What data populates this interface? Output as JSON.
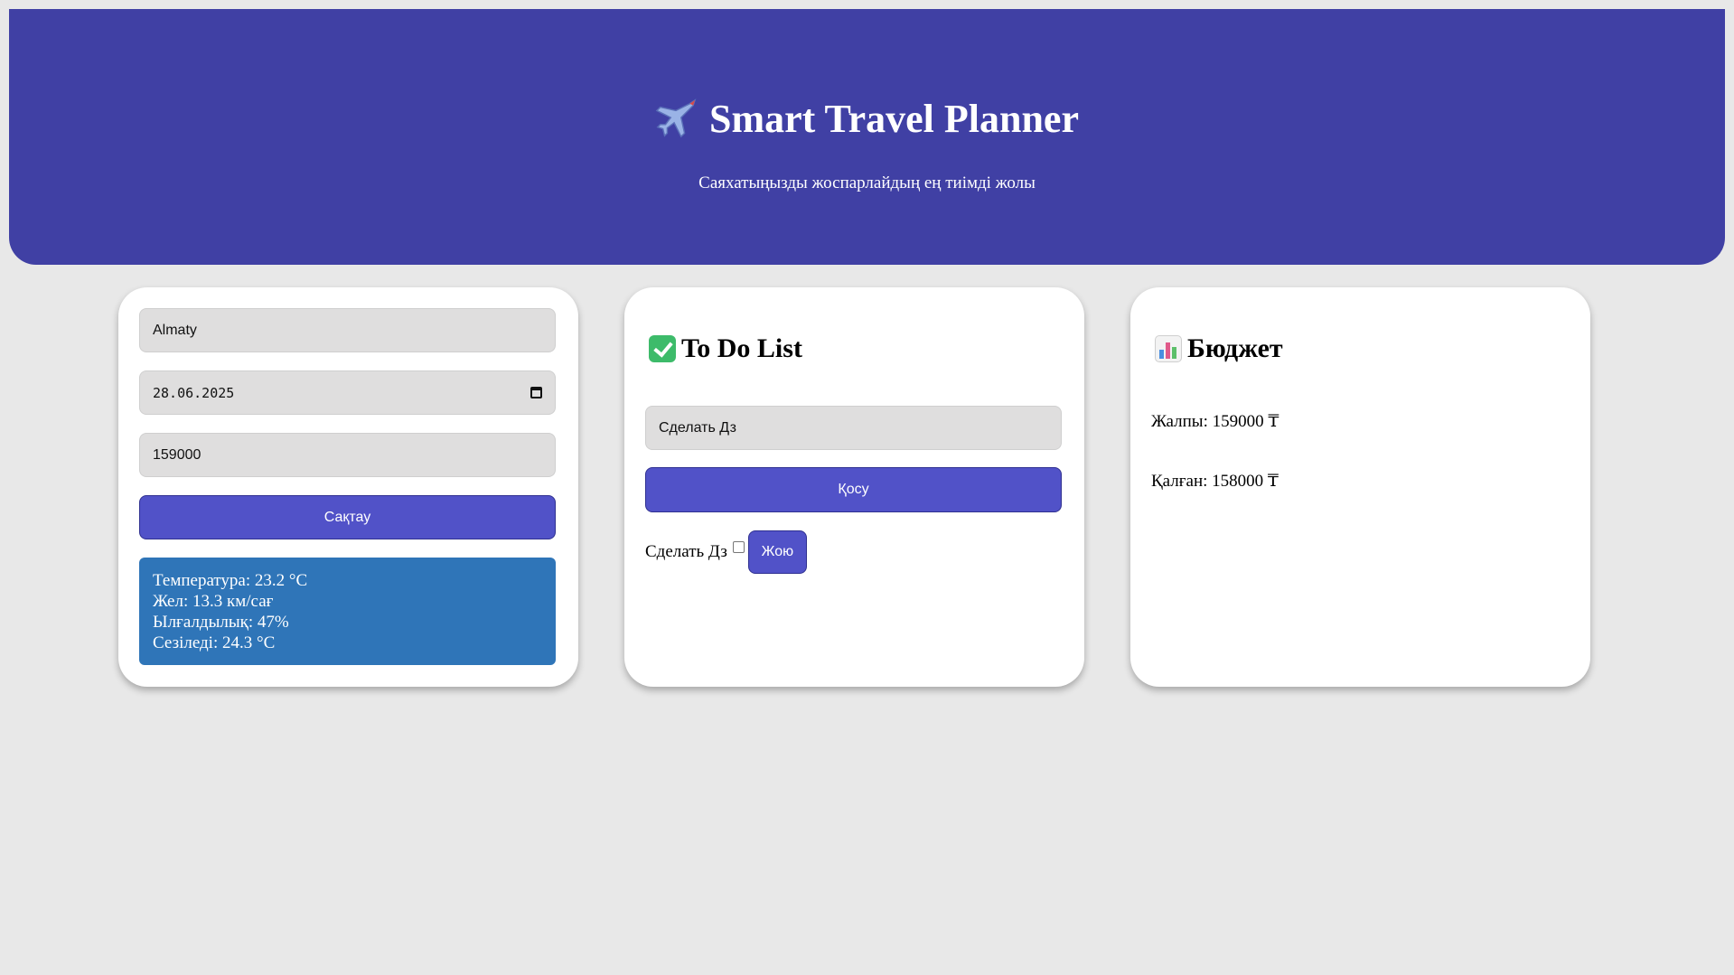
{
  "header": {
    "title": "Smart Travel Planner",
    "subtitle": "Саяхатыңызды жоспарлайдың ең тиімді жолы",
    "background_color": "#4040a4",
    "title_icon": "airplane-icon"
  },
  "trip_form": {
    "city_value": "Almaty",
    "date_value": "28.06.2025",
    "budget_value": "159000",
    "save_label": "Сақтау",
    "accent_color": "#5152c8"
  },
  "weather": {
    "temperature": "Температура: 23.2 °C",
    "wind": "Жел: 13.3 км/сағ",
    "humidity": "Ылғалдылық: 47%",
    "feels_like": "Сезіледі: 24.3 °C",
    "background_color": "#2f75b8"
  },
  "todo": {
    "title": "To Do List",
    "title_icon": "check-icon",
    "input_value": "Сделать Дз",
    "add_label": "Қосу",
    "items": [
      {
        "text": "Сделать Дз",
        "done": false,
        "delete_label": "Жою"
      }
    ]
  },
  "budget": {
    "title": "Бюджет",
    "title_icon": "bar-chart-icon",
    "total": "Жалпы: 159000 ₸",
    "remaining": "Қалған: 158000 ₸"
  }
}
